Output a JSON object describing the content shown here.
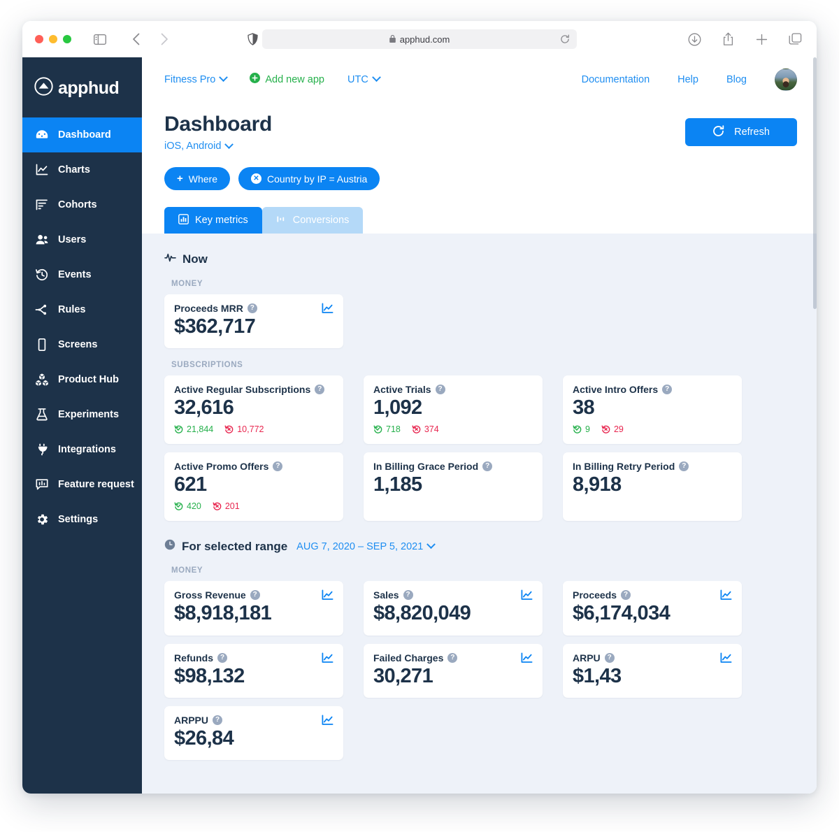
{
  "browser": {
    "url": "apphud.com",
    "lock_icon": "lock-icon",
    "reload_icon": "reload-icon",
    "shield_icon": "shield-icon",
    "sidebar_toggle_icon": "sidebar-toggle-icon",
    "back_icon": "chevron-left-icon",
    "forward_icon": "chevron-right-icon",
    "download_icon": "download-icon",
    "share_icon": "share-icon",
    "newtab_icon": "plus-icon",
    "tabs_icon": "tabs-overview-icon"
  },
  "sidebar": {
    "brand": "apphud",
    "items": [
      {
        "label": "Dashboard",
        "icon": "dashboard-icon",
        "active": true
      },
      {
        "label": "Charts",
        "icon": "chart-icon",
        "active": false
      },
      {
        "label": "Cohorts",
        "icon": "cohorts-icon",
        "active": false
      },
      {
        "label": "Users",
        "icon": "users-icon",
        "active": false
      },
      {
        "label": "Events",
        "icon": "events-clock-icon",
        "active": false
      },
      {
        "label": "Rules",
        "icon": "rules-branch-icon",
        "active": false
      },
      {
        "label": "Screens",
        "icon": "phone-icon",
        "active": false
      },
      {
        "label": "Product Hub",
        "icon": "boxes-icon",
        "active": false
      },
      {
        "label": "Experiments",
        "icon": "flask-icon",
        "active": false
      },
      {
        "label": "Integrations",
        "icon": "plug-icon",
        "active": false
      },
      {
        "label": "Feature request",
        "icon": "feedback-icon",
        "active": false
      },
      {
        "label": "Settings",
        "icon": "gear-icon",
        "active": false
      }
    ]
  },
  "topbar": {
    "app_selector": "Fitness Pro",
    "add_new_app": "Add new app",
    "timezone": "UTC",
    "documentation": "Documentation",
    "help": "Help",
    "blog": "Blog"
  },
  "page": {
    "title": "Dashboard",
    "platforms": "iOS, Android",
    "refresh_label": "Refresh"
  },
  "filters": {
    "where_label": "Where",
    "active_chip": "Country by IP = Austria"
  },
  "tabs": [
    {
      "label": "Key metrics",
      "icon": "bar-chart-icon",
      "active": true
    },
    {
      "label": "Conversions",
      "icon": "funnel-icon",
      "active": false
    }
  ],
  "now_section": {
    "heading": "Now",
    "icon": "pulse-icon",
    "groups": [
      {
        "label": "MONEY",
        "cards": [
          {
            "title": "Proceeds MRR",
            "value": "$362,717",
            "has_chart_icon": true,
            "substats": []
          }
        ]
      },
      {
        "label": "SUBSCRIPTIONS",
        "cards": [
          {
            "title": "Active Regular Subscriptions",
            "value": "32,616",
            "has_chart_icon": false,
            "substats": [
              {
                "kind": "up",
                "value": "21,844"
              },
              {
                "kind": "down",
                "value": "10,772"
              }
            ]
          },
          {
            "title": "Active Trials",
            "value": "1,092",
            "has_chart_icon": false,
            "substats": [
              {
                "kind": "up",
                "value": "718"
              },
              {
                "kind": "down",
                "value": "374"
              }
            ]
          },
          {
            "title": "Active Intro Offers",
            "value": "38",
            "has_chart_icon": false,
            "substats": [
              {
                "kind": "up",
                "value": "9"
              },
              {
                "kind": "down",
                "value": "29"
              }
            ]
          },
          {
            "title": "Active Promo Offers",
            "value": "621",
            "has_chart_icon": false,
            "substats": [
              {
                "kind": "up",
                "value": "420"
              },
              {
                "kind": "down",
                "value": "201"
              }
            ]
          },
          {
            "title": "In Billing Grace Period",
            "value": "1,185",
            "has_chart_icon": false,
            "substats": []
          },
          {
            "title": "In Billing Retry Period",
            "value": "8,918",
            "has_chart_icon": false,
            "substats": []
          }
        ]
      }
    ]
  },
  "range_section": {
    "heading": "For selected range",
    "icon": "clock-icon",
    "range": "AUG 7, 2020 – SEP 5, 2021",
    "groups": [
      {
        "label": "MONEY",
        "cards": [
          {
            "title": "Gross Revenue",
            "value": "$8,918,181",
            "has_chart_icon": true,
            "substats": []
          },
          {
            "title": "Sales",
            "value": "$8,820,049",
            "has_chart_icon": true,
            "substats": []
          },
          {
            "title": "Proceeds",
            "value": "$6,174,034",
            "has_chart_icon": true,
            "substats": []
          },
          {
            "title": "Refunds",
            "value": "$98,132",
            "has_chart_icon": true,
            "substats": []
          },
          {
            "title": "Failed Charges",
            "value": "30,271",
            "has_chart_icon": true,
            "substats": []
          },
          {
            "title": "ARPU",
            "value": "$1,43",
            "has_chart_icon": true,
            "substats": []
          },
          {
            "title": "ARPPU",
            "value": "$26,84",
            "has_chart_icon": true,
            "substats": []
          }
        ]
      }
    ]
  },
  "colors": {
    "accent_blue": "#0b84f3",
    "link_blue": "#1f8ef1",
    "sidebar_navy": "#1d3249",
    "content_bg": "#eef2f9",
    "green": "#25b04b",
    "red": "#e8264f",
    "tab_inactive": "#b4d9f8"
  },
  "help_glyph": "?"
}
